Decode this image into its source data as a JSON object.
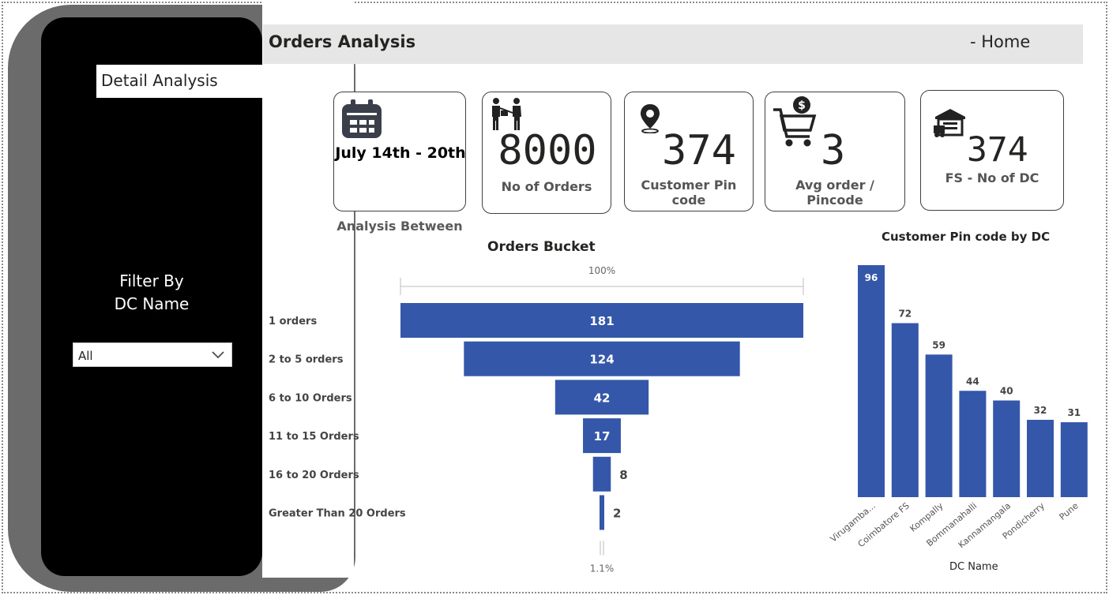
{
  "header": {
    "title": "Orders Analysis",
    "home_link": "- Home"
  },
  "sidebar": {
    "detail_button": "Detail Analysis",
    "filter_label_line1": "Filter By",
    "filter_label_line2": "DC Name",
    "dc_select_value": "All"
  },
  "kpis": {
    "period": {
      "value": "July 14th - 20th",
      "caption": "Analysis Between",
      "icon": "calendar-icon"
    },
    "orders": {
      "value": "8000",
      "label": "No of Orders",
      "icon": "people-handover-icon"
    },
    "pincodes": {
      "value": "374",
      "label": "Customer Pin code",
      "icon": "location-pin-icon"
    },
    "avg_order": {
      "value": "3",
      "label": "Avg order / Pincode",
      "icon": "shopping-cart-dollar-icon"
    },
    "dc_count": {
      "value": "374",
      "label": "FS - No of DC",
      "icon": "warehouse-truck-icon"
    }
  },
  "colors": {
    "bar": "#3457aa",
    "panel_dark": "#000000",
    "panel_gray": "#6b6b6b",
    "header_bg": "#e6e6e6"
  },
  "funnel": {
    "title": "Orders Bucket",
    "top_percent": "100%",
    "bottom_percent": "1.1%"
  },
  "bar_chart": {
    "title": "Customer Pin code by DC",
    "xlabel": "DC Name"
  },
  "chart_data": [
    {
      "type": "funnel",
      "title": "Orders Bucket",
      "categories": [
        "1 orders",
        "2 to 5 orders",
        "6 to 10 Orders",
        "11 to 15 Orders",
        "16 to 20 Orders",
        "Greater Than 20 Orders"
      ],
      "values": [
        181,
        124,
        42,
        17,
        8,
        2
      ],
      "top_label": "100%",
      "bottom_label": "1.1%"
    },
    {
      "type": "bar",
      "title": "Customer Pin code by DC",
      "xlabel": "DC Name",
      "ylabel": "",
      "categories": [
        "Virugamba...",
        "Coimbatore FS",
        "Kompally",
        "Bommanahalli",
        "Kannamangala",
        "Pondicherry",
        "Pune"
      ],
      "values": [
        96,
        72,
        59,
        44,
        40,
        32,
        31
      ],
      "ylim": [
        0,
        96
      ],
      "grid": false
    }
  ]
}
